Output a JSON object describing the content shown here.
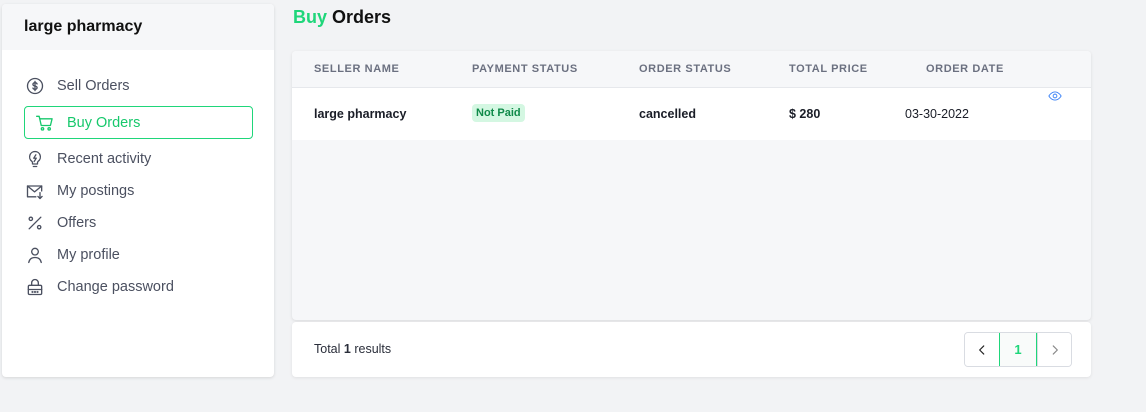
{
  "sidebar": {
    "header": "large pharmacy",
    "items": [
      {
        "label": "Sell Orders",
        "icon": "dollar-circle-icon",
        "active": false
      },
      {
        "label": "Buy Orders",
        "icon": "cart-icon",
        "active": true
      },
      {
        "label": "Recent activity",
        "icon": "lightbulb-icon",
        "active": false
      },
      {
        "label": "My postings",
        "icon": "mail-download-icon",
        "active": false
      },
      {
        "label": "Offers",
        "icon": "percent-icon",
        "active": false
      },
      {
        "label": "My profile",
        "icon": "user-icon",
        "active": false
      },
      {
        "label": "Change password",
        "icon": "lock-icon",
        "active": false
      }
    ]
  },
  "page": {
    "title_accent": "Buy",
    "title_rest": "Orders"
  },
  "table": {
    "headers": {
      "seller": "SELLER NAME",
      "payment": "PAYMENT STATUS",
      "order": "ORDER STATUS",
      "price": "TOTAL PRICE",
      "date": "ORDER DATE"
    },
    "rows": [
      {
        "seller": "large pharmacy",
        "payment": "Not Paid",
        "order": "cancelled",
        "price": "$ 280",
        "date": "03-30-2022",
        "action_icon": "eye-icon"
      }
    ]
  },
  "footer": {
    "total_prefix": "Total",
    "total_count": "1",
    "total_suffix": "results",
    "pages": [
      "1"
    ],
    "current_page": "1"
  },
  "colors": {
    "accent": "#1fd67a",
    "badge_bg": "#d4f7e2",
    "badge_text": "#0f8a49",
    "view_icon": "#3b82f6"
  }
}
